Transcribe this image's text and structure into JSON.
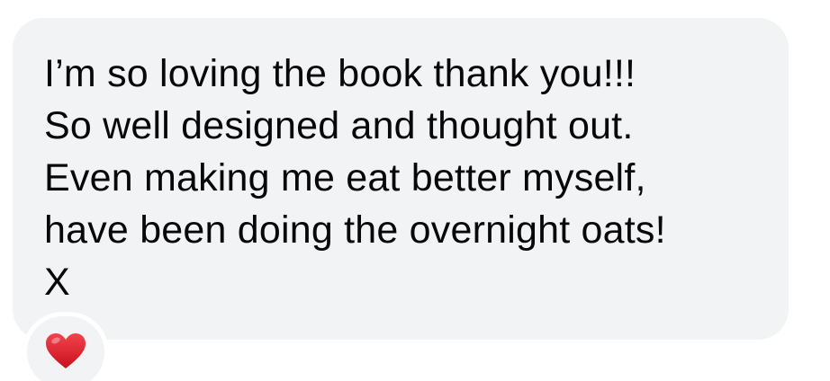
{
  "message": {
    "lines": [
      "I’m so loving the book thank you!!!",
      "So well designed and thought out.",
      "Even making me eat better myself,",
      "have been doing the overnight oats!",
      "X"
    ]
  },
  "reaction": {
    "icon": "heart-icon",
    "color": "#e0202b"
  },
  "colors": {
    "bubble": "#f2f3f5",
    "text": "#080809",
    "background": "#ffffff"
  }
}
